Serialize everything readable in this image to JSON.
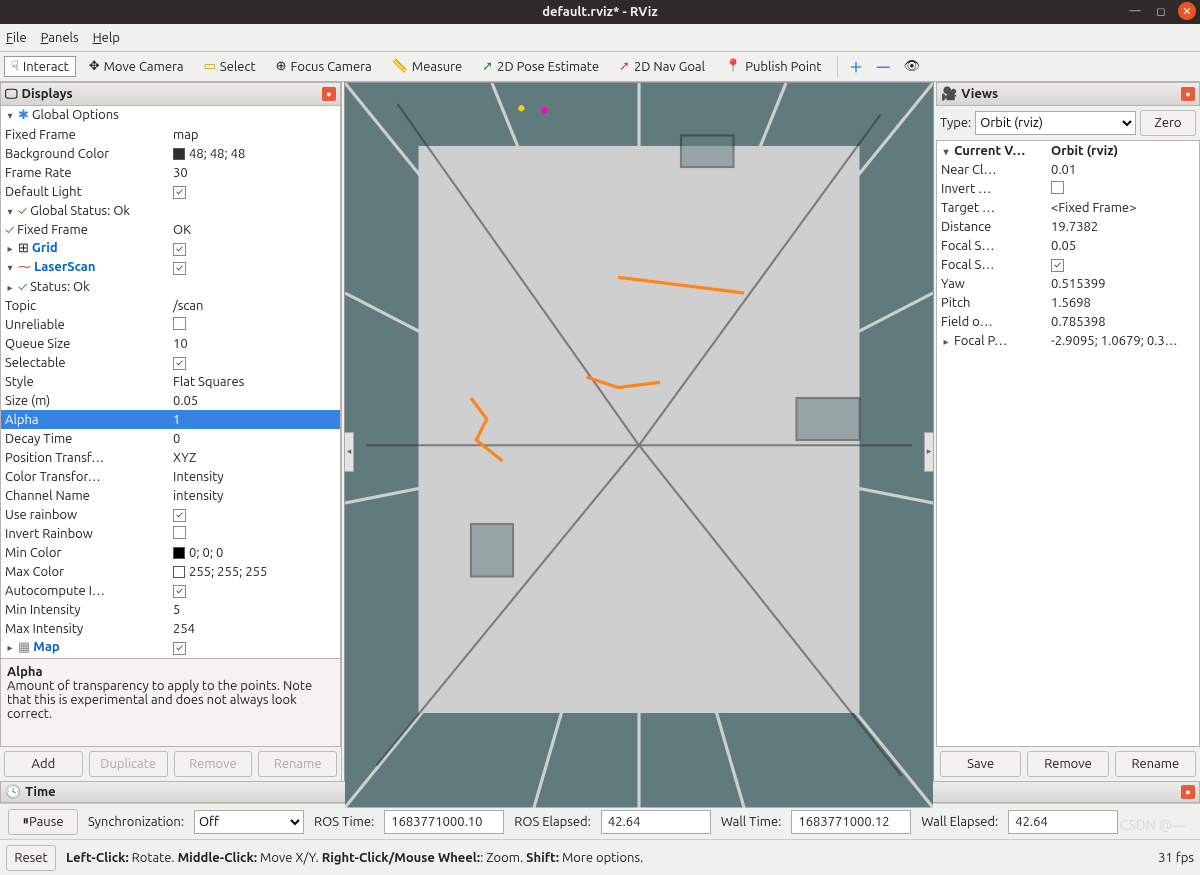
{
  "window": {
    "title": "default.rviz* - RViz"
  },
  "menus": {
    "file": "File",
    "panels": "Panels",
    "help": "Help"
  },
  "toolbar": {
    "interact": "Interact",
    "move": "Move Camera",
    "select": "Select",
    "focus": "Focus Camera",
    "measure": "Measure",
    "pose": "2D Pose Estimate",
    "goal": "2D Nav Goal",
    "publish": "Publish Point"
  },
  "displays": {
    "title": "Displays",
    "global_options": "Global Options",
    "fixed_frame_k": "Fixed Frame",
    "fixed_frame_v": "map",
    "bg_k": "Background Color",
    "bg_v": "48; 48; 48",
    "fr_k": "Frame Rate",
    "fr_v": "30",
    "dl_k": "Default Light",
    "gstatus": "Global Status: Ok",
    "gstatus_ff_k": "Fixed Frame",
    "gstatus_ff_v": "OK",
    "grid": "Grid",
    "laser": "LaserScan",
    "status_ok": "Status: Ok",
    "topic_k": "Topic",
    "topic_v": "/scan",
    "unrel": "Unreliable",
    "queue_k": "Queue Size",
    "queue_v": "10",
    "selectable": "Selectable",
    "style_k": "Style",
    "style_v": "Flat Squares",
    "size_k": "Size (m)",
    "size_v": "0.05",
    "alpha_k": "Alpha",
    "alpha_v": "1",
    "decay_k": "Decay Time",
    "decay_v": "0",
    "pt_k": "Position Transf…",
    "pt_v": "XYZ",
    "ct_k": "Color Transfor…",
    "ct_v": "Intensity",
    "chan_k": "Channel Name",
    "chan_v": "intensity",
    "rainbow_k": "Use rainbow",
    "invrain_k": "Invert Rainbow",
    "minc_k": "Min Color",
    "minc_v": "0; 0; 0",
    "maxc_k": "Max Color",
    "maxc_v": "255; 255; 255",
    "autoc_k": "Autocompute I…",
    "mini_k": "Min Intensity",
    "mini_v": "5",
    "maxi_k": "Max Intensity",
    "maxi_v": "254",
    "map": "Map",
    "help_title": "Alpha",
    "help_body": "Amount of transparency to apply to the points. Note that this is experimental and does not always look correct.",
    "btn_add": "Add",
    "btn_dup": "Duplicate",
    "btn_remove": "Remove",
    "btn_rename": "Rename"
  },
  "views": {
    "title": "Views",
    "type_label": "Type:",
    "type_value": "Orbit (rviz)",
    "zero": "Zero",
    "current": "Current V…",
    "current_v": "Orbit (rviz)",
    "near": "Near Cl…",
    "near_v": "0.01",
    "invert": "Invert …",
    "target": "Target …",
    "target_v": "<Fixed Frame>",
    "dist": "Distance",
    "dist_v": "19.7382",
    "fs1": "Focal S…",
    "fs1_v": "0.05",
    "fs2": "Focal S…",
    "yaw": "Yaw",
    "yaw_v": "0.515399",
    "pitch": "Pitch",
    "pitch_v": "1.5698",
    "fov": "Field o…",
    "fov_v": "0.785398",
    "fp": "Focal P…",
    "fp_v": "-2.9095; 1.0679; 0.3…",
    "btn_save": "Save",
    "btn_remove": "Remove",
    "btn_rename": "Rename"
  },
  "time": {
    "title": "Time",
    "pause": "Pause",
    "sync": "Synchronization:",
    "sync_v": "Off",
    "ros_time": "ROS Time:",
    "ros_time_v": "1683771000.10",
    "ros_el": "ROS Elapsed:",
    "ros_el_v": "42.64",
    "wall_time": "Wall Time:",
    "wall_time_v": "1683771000.12",
    "wall_el": "Wall Elapsed:",
    "wall_el_v": "42.64"
  },
  "status": {
    "reset": "Reset",
    "hint": "Left-Click: Rotate. Middle-Click: Move X/Y. Right-Click/Mouse Wheel:: Zoom. Shift: More options.",
    "fps": "31 fps"
  },
  "watermark": "CSDN @—"
}
